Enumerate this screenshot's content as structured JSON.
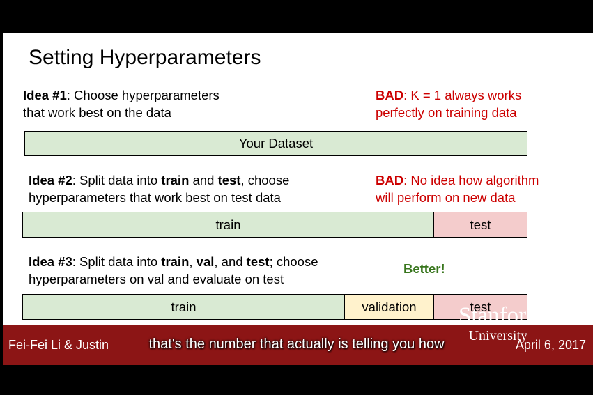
{
  "slide": {
    "title": "Setting Hyperparameters",
    "idea1": {
      "label": "Idea #1",
      "line1": ": Choose hyperparameters",
      "line2": "that work best on the data"
    },
    "bad1": {
      "label": "BAD",
      "line1": ": K = 1 always works",
      "line2": "perfectly on training data"
    },
    "bar1": {
      "dataset": "Your Dataset"
    },
    "idea2": {
      "label": "Idea #2",
      "t1": ": Split data into ",
      "k1": "train",
      "t2": " and ",
      "k2": "test",
      "t3": ", choose",
      "line2": "hyperparameters that work best on test data"
    },
    "bad2": {
      "label": "BAD",
      "line1": ": No idea how algorithm",
      "line2": "will perform on new data"
    },
    "bar2": {
      "train": "train",
      "test": "test"
    },
    "idea3": {
      "label": "Idea #3",
      "t1": ": Split data into ",
      "k1": "train",
      "t2": ", ",
      "k2": "val",
      "t3": ", and ",
      "k3": "test",
      "t4": "; choose",
      "line2": "hyperparameters on val and evaluate on test"
    },
    "better": "Better!",
    "bar3": {
      "train": "train",
      "validation": "validation",
      "test": "test"
    }
  },
  "footer": {
    "left": "Fei-Fei Li & Justin",
    "right": "April 6, 2017",
    "logo_line1": "Stanford",
    "logo_line2": "University"
  },
  "caption": "that's the number that actually is telling you how",
  "colors": {
    "bad": "#cc0000",
    "better": "#38761d",
    "footer_bg": "#8c1515",
    "train": "#d9ead3",
    "test": "#f4cccc",
    "validation": "#fff2cc"
  }
}
